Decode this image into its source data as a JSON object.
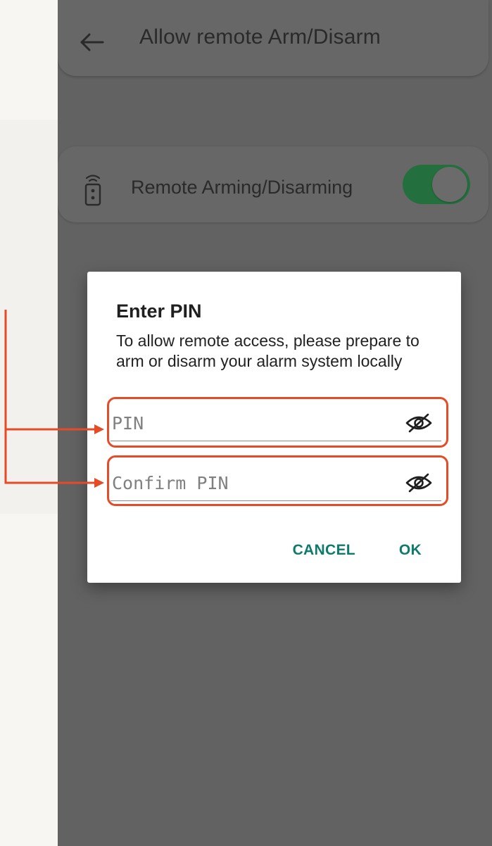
{
  "appbar": {
    "title": "Allow remote Arm/Disarm",
    "back_icon": "arrow-left-icon"
  },
  "setting": {
    "label": "Remote Arming/Disarming",
    "icon": "remote-control-icon",
    "toggle_on": true,
    "toggle_color": "#246f3e"
  },
  "dialog": {
    "title": "Enter PIN",
    "message": "To allow remote access, please prepare to arm or disarm your alarm system locally",
    "pin_placeholder": "PIN",
    "confirm_placeholder": "Confirm PIN",
    "visibility_icon": "eye-off-icon",
    "cancel_label": "CANCEL",
    "ok_label": "OK",
    "action_color": "#0e7a6b"
  },
  "annotation": {
    "color": "#e54b26"
  }
}
